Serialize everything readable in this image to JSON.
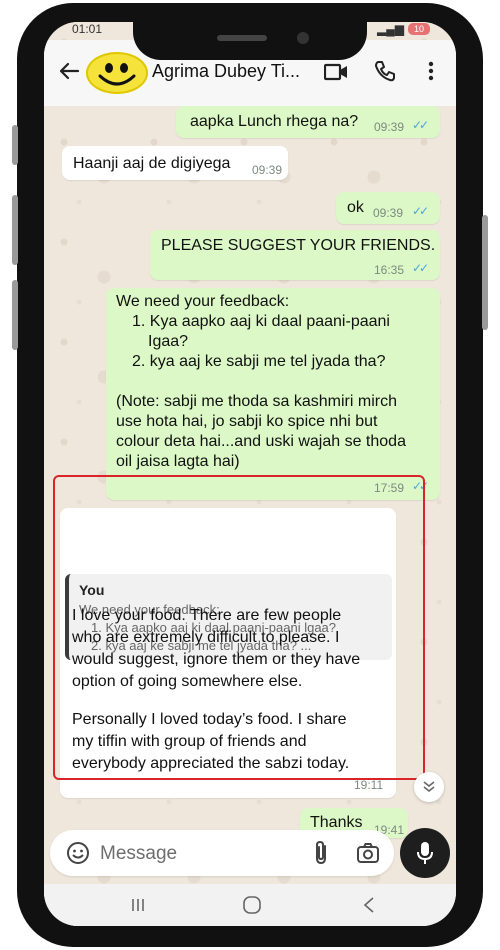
{
  "status": {
    "time": "01:01",
    "battery": "10"
  },
  "header": {
    "contact_name": "Agrima Dubey Ti..."
  },
  "messages": [
    {
      "text": "aapka Lunch rhega na?",
      "time": "09:39"
    },
    {
      "text": "Haanji aaj de digiyega",
      "time": "09:39"
    },
    {
      "text": "ok",
      "time": "09:39"
    },
    {
      "text": "PLEASE SUGGEST YOUR FRIENDS.",
      "time": "16:35"
    },
    {
      "intro": "We need your feedback:",
      "item1": "1. Kya aapko aaj ki daal paani-paani",
      "item1b": "Igaa?",
      "item2": "2. kya aaj ke sabji me tel jyada tha?",
      "note1": "(Note: sabji me thoda sa kashmiri mirch",
      "note2": "use hota hai, jo sabji ko spice nhi but",
      "note3": "colour deta hai...and uski wajah se thoda",
      "note4": "oil jaisa lagta hai)",
      "time": "17:59"
    },
    {
      "quote_author": "You",
      "quote_line1": "We need your feedback:",
      "quote_line2": "1. Kya aapko aaj ki daal paani-paani lgaa?",
      "quote_line3": "2. kya aaj ke sabji me tel jyada tha? ...",
      "p1_l1": "I love your food. There are few people",
      "p1_l2": "who are extremely difficult to please. I",
      "p1_l3": "would suggest, ignore them or they have",
      "p1_l4": "option of going somewhere else.",
      "p2_l1": "Personally I loved today’s food. I share",
      "p2_l2": "my tiffin with group of friends and",
      "p2_l3": "everybody appreciated the sabzi today.",
      "time": "19:11"
    },
    {
      "text": "Thanks",
      "time": "19:41"
    }
  ],
  "input": {
    "placeholder": "Message"
  },
  "colors": {
    "outgoing": "#dcf8c6",
    "incoming": "#ffffff",
    "highlight": "#d9252a",
    "ticks": "#4fa3e0"
  }
}
